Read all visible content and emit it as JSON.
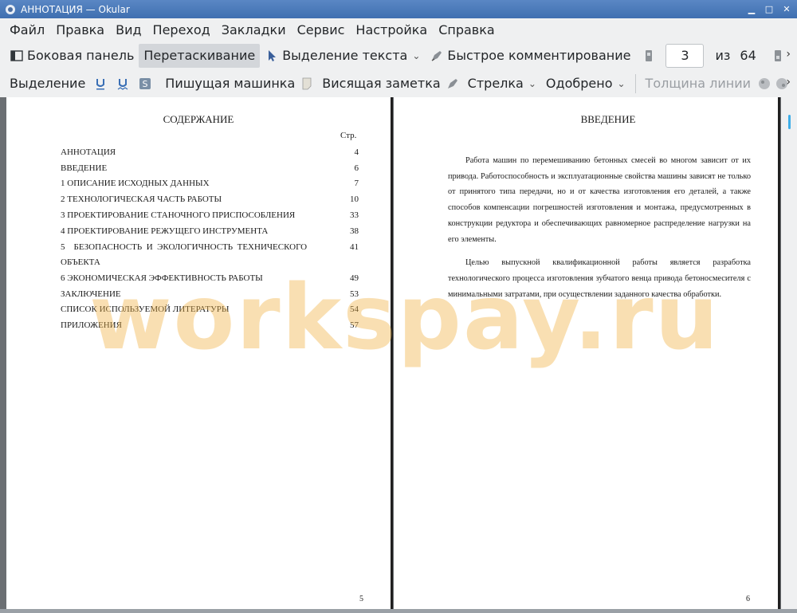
{
  "window": {
    "title": "АННОТАЦИЯ  — Okular"
  },
  "menu": [
    "Файл",
    "Правка",
    "Вид",
    "Переход",
    "Закладки",
    "Сервис",
    "Настройка",
    "Справка"
  ],
  "toolbar1": {
    "sidebar": "Боковая панель",
    "browse": "Перетаскивание",
    "text_select": "Выделение текста",
    "quick_annotate": "Быстрое комментирование",
    "page_current": "3",
    "page_of": "из",
    "page_total": "64"
  },
  "toolbar2": {
    "highlight": "Выделение",
    "typewriter": "Пишущая машинка",
    "note": "Висящая заметка",
    "arrow": "Стрелка",
    "stamp": "Одобрено",
    "line_width": "Толщина линии"
  },
  "left_page": {
    "heading": "СОДЕРЖАНИЕ",
    "page_col": "Стр.",
    "toc": [
      {
        "title": "АННОТАЦИЯ",
        "page": "4"
      },
      {
        "title": "ВВЕДЕНИЕ",
        "page": "6"
      },
      {
        "title": "1  ОПИСАНИЕ ИСХОДНЫХ ДАННЫХ",
        "page": "7"
      },
      {
        "title": "2  ТЕХНОЛОГИЧЕСКАЯ ЧАСТЬ РАБОТЫ",
        "page": "10"
      },
      {
        "title": "3  ПРОЕКТИРОВАНИЕ СТАНОЧНОГО ПРИСПОСОБЛЕНИЯ",
        "page": "33"
      },
      {
        "title": "4  ПРОЕКТИРОВАНИЕ РЕЖУЩЕГО ИНСТРУМЕНТА",
        "page": "38"
      },
      {
        "title": "5    БЕЗОПАСНОСТЬ  И  ЭКОЛОГИЧНОСТЬ  ТЕХНИЧЕСКОГО",
        "page": "41"
      },
      {
        "title": "ОБЪЕКТА",
        "page": ""
      },
      {
        "title": "6  ЭКОНОМИЧЕСКАЯ ЭФФЕКТИВНОСТЬ РАБОТЫ",
        "page": "49"
      },
      {
        "title": "ЗАКЛЮЧЕНИЕ",
        "page": "53"
      },
      {
        "title": "СПИСОК ИСПОЛЬЗУЕМОЙ ЛИТЕРАТУРЫ",
        "page": "54"
      },
      {
        "title": "ПРИЛОЖЕНИЯ",
        "page": "57"
      }
    ],
    "page_number": "5"
  },
  "right_page": {
    "heading": "ВВЕДЕНИЕ",
    "paragraphs": [
      "Работа машин по перемешиванию бетонных смесей во многом зависит от их привода. Работоспособность и эксплуатационные свойства машины зависят не только от принятого типа передачи, но и от качества изготовления его деталей, а также способов компенсации погрешностей изготовления и монтажа, предусмотренных в конструкции редуктора и обеспечивающих равномерное распределение нагрузки на его элементы.",
      "Целью выпускной квалификационной работы является разработка технологического процесса изготовления зубчатого венца привода бетоносмесителя с минимальными затратами, при осуществлении заданного качества обработки."
    ],
    "page_number": "6"
  },
  "watermark": "workspay.ru"
}
